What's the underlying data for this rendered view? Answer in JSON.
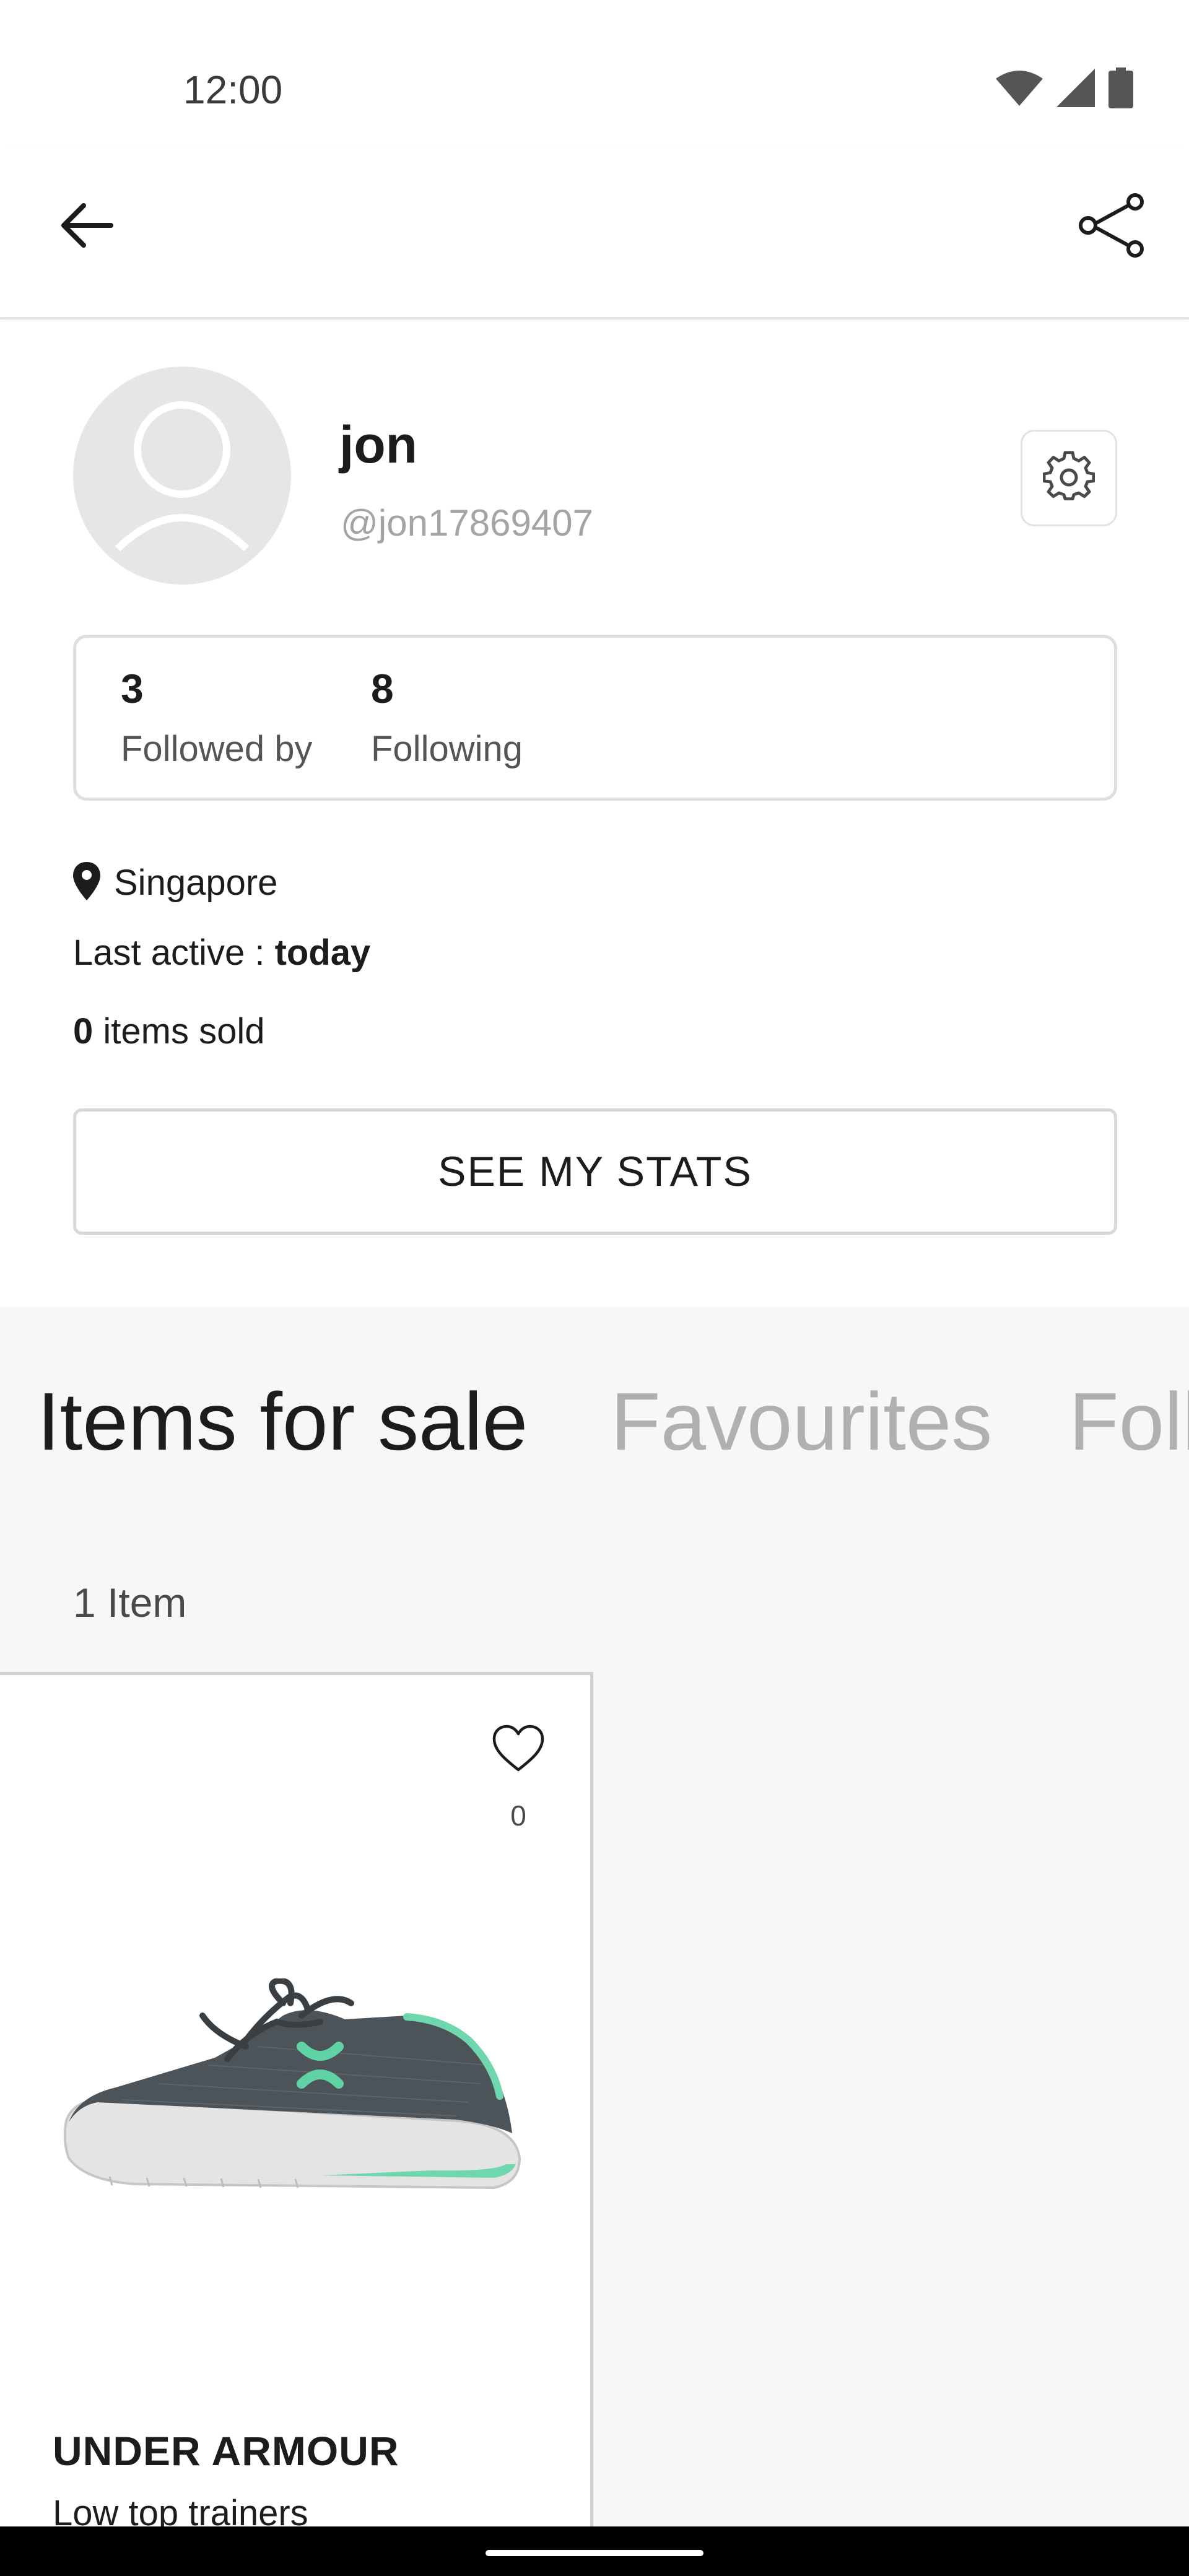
{
  "status_bar": {
    "time": "12:00",
    "icons": [
      "wifi-icon",
      "signal-icon",
      "battery-icon"
    ]
  },
  "app_bar": {
    "back_icon": "arrow-left-icon",
    "share_icon": "share-icon"
  },
  "profile": {
    "display_name": "jon",
    "username": "@jon17869407",
    "settings_icon": "gear-icon",
    "followed_by_count": "3",
    "followed_by_label": "Followed by",
    "following_count": "8",
    "following_label": "Following",
    "location": "Singapore",
    "last_active_label": "Last active : ",
    "last_active_value": "today",
    "items_sold_count": "0",
    "items_sold_label": " items sold",
    "stats_button_label": "SEE MY STATS"
  },
  "tabs": [
    {
      "label": "Items for sale",
      "active": true
    },
    {
      "label": "Favourites",
      "active": false
    },
    {
      "label": "Foll",
      "active": false
    }
  ],
  "listing": {
    "item_count_label": "1 Item",
    "items": [
      {
        "brand": "UNDER ARMOUR",
        "name": "Low top trainers",
        "likes": "0",
        "image": "grey sneaker with mint green logo"
      }
    ]
  },
  "colors": {
    "text_primary": "#1c1c1c",
    "text_muted": "#a4a4a4",
    "tab_inactive": "#b0b0b0",
    "content_background": "#f7f7f7",
    "shoe_accent": "#5fd3a6"
  }
}
